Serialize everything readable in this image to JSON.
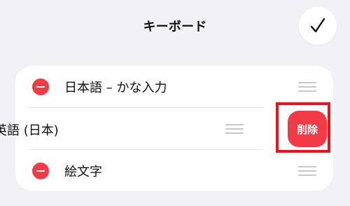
{
  "header": {
    "title": "キーボード",
    "done_icon": "checkmark-icon"
  },
  "list": {
    "items": [
      {
        "label": "日本語 – かな入力",
        "remove_icon": "minus-circle-icon",
        "reorder_icon": "drag-handle-icon"
      },
      {
        "label": "英語 (日本)",
        "reorder_icon": "drag-handle-icon"
      },
      {
        "label": "絵文字",
        "remove_icon": "minus-circle-icon",
        "reorder_icon": "drag-handle-icon"
      }
    ]
  },
  "swipe_action": {
    "delete_label": "削除",
    "color": "#f23b46",
    "highlight_color": "#e6141e"
  }
}
